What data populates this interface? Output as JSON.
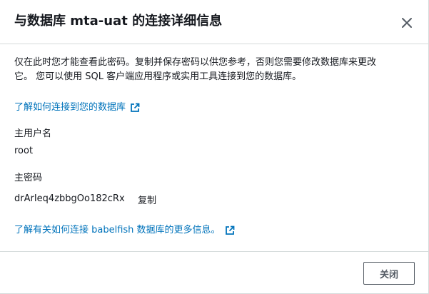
{
  "dialog": {
    "title": "与数据库 mta-uat 的连接详细信息",
    "notice_line1": "仅在此时您才能查看此密码。复制并保存密码以供您参考，否则您需要修改数据库来更改",
    "notice_line2": "它。 您可以使用 SQL 客户端应用程序或实用工具连接到您的数据库。",
    "connect_link": "了解如何连接到您的数据库",
    "master_username_label": "主用户名",
    "master_username_value": "root",
    "master_password_label": "主密码",
    "master_password_value": "drArIeq4zbbgOo182cRx",
    "copy_label": "复制",
    "babelfish_link": "了解有关如何连接 babelfish 数据库的更多信息。",
    "close_button": "关闭"
  },
  "icons": {
    "close": "close-icon",
    "external": "external-link-icon"
  },
  "colors": {
    "link": "#0073bb",
    "text": "#16191f",
    "border": "#d5dbdb",
    "button_border": "#545b64"
  }
}
